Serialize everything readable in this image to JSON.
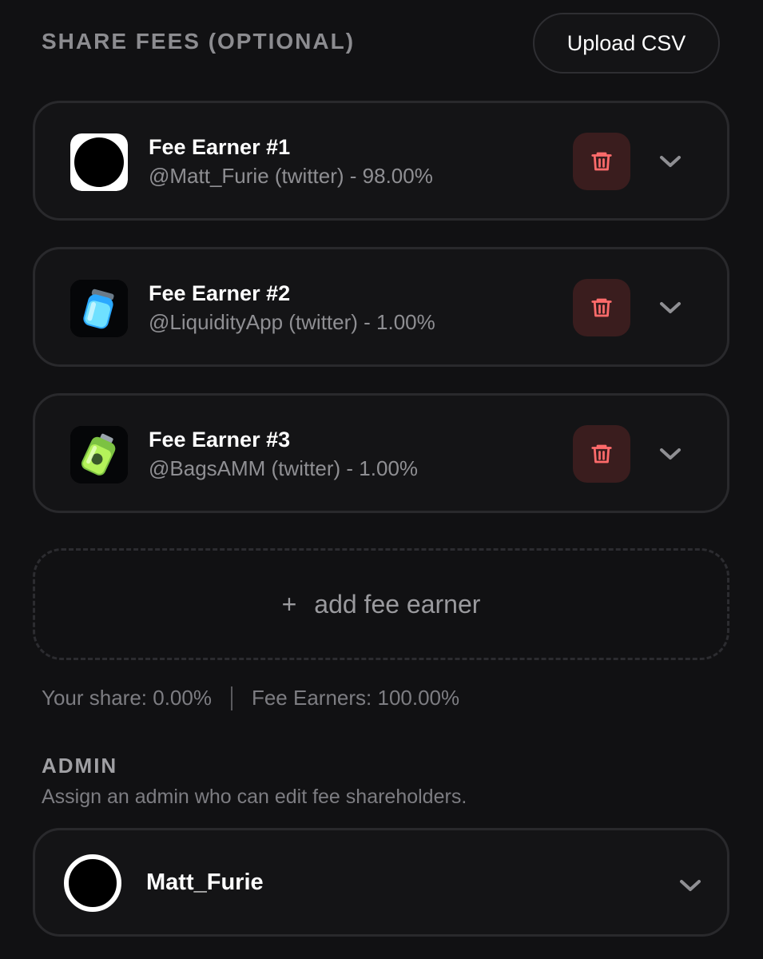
{
  "header": {
    "title": "SHARE FEES (OPTIONAL)",
    "upload_label": "Upload CSV"
  },
  "fee_earners": [
    {
      "name": "Fee Earner #1",
      "handle": "@Matt_Furie (twitter) - 98.00%",
      "avatar": "black-circle-avatar"
    },
    {
      "name": "Fee Earner #2",
      "handle": "@LiquidityApp (twitter) - 1.00%",
      "avatar": "blue-potion-jar-avatar"
    },
    {
      "name": "Fee Earner #3",
      "handle": "@BagsAMM (twitter) - 1.00%",
      "avatar": "green-battery-jar-avatar"
    }
  ],
  "add_earner": {
    "plus": "+",
    "label": "add fee earner"
  },
  "summary": {
    "your_share": "Your share: 0.00%",
    "fee_earners": "Fee Earners: 100.00%"
  },
  "admin": {
    "title": "ADMIN",
    "description": "Assign an admin who can edit fee shareholders.",
    "selected_name": "Matt_Furie"
  },
  "icons": {
    "delete": "trash-icon",
    "expand": "chevron-down-icon"
  },
  "colors": {
    "background": "#111113",
    "card_border": "#29292c",
    "delete_bg": "#3a1d1e",
    "delete_icon": "#ff6b6b",
    "muted_text": "#8f8f93"
  }
}
